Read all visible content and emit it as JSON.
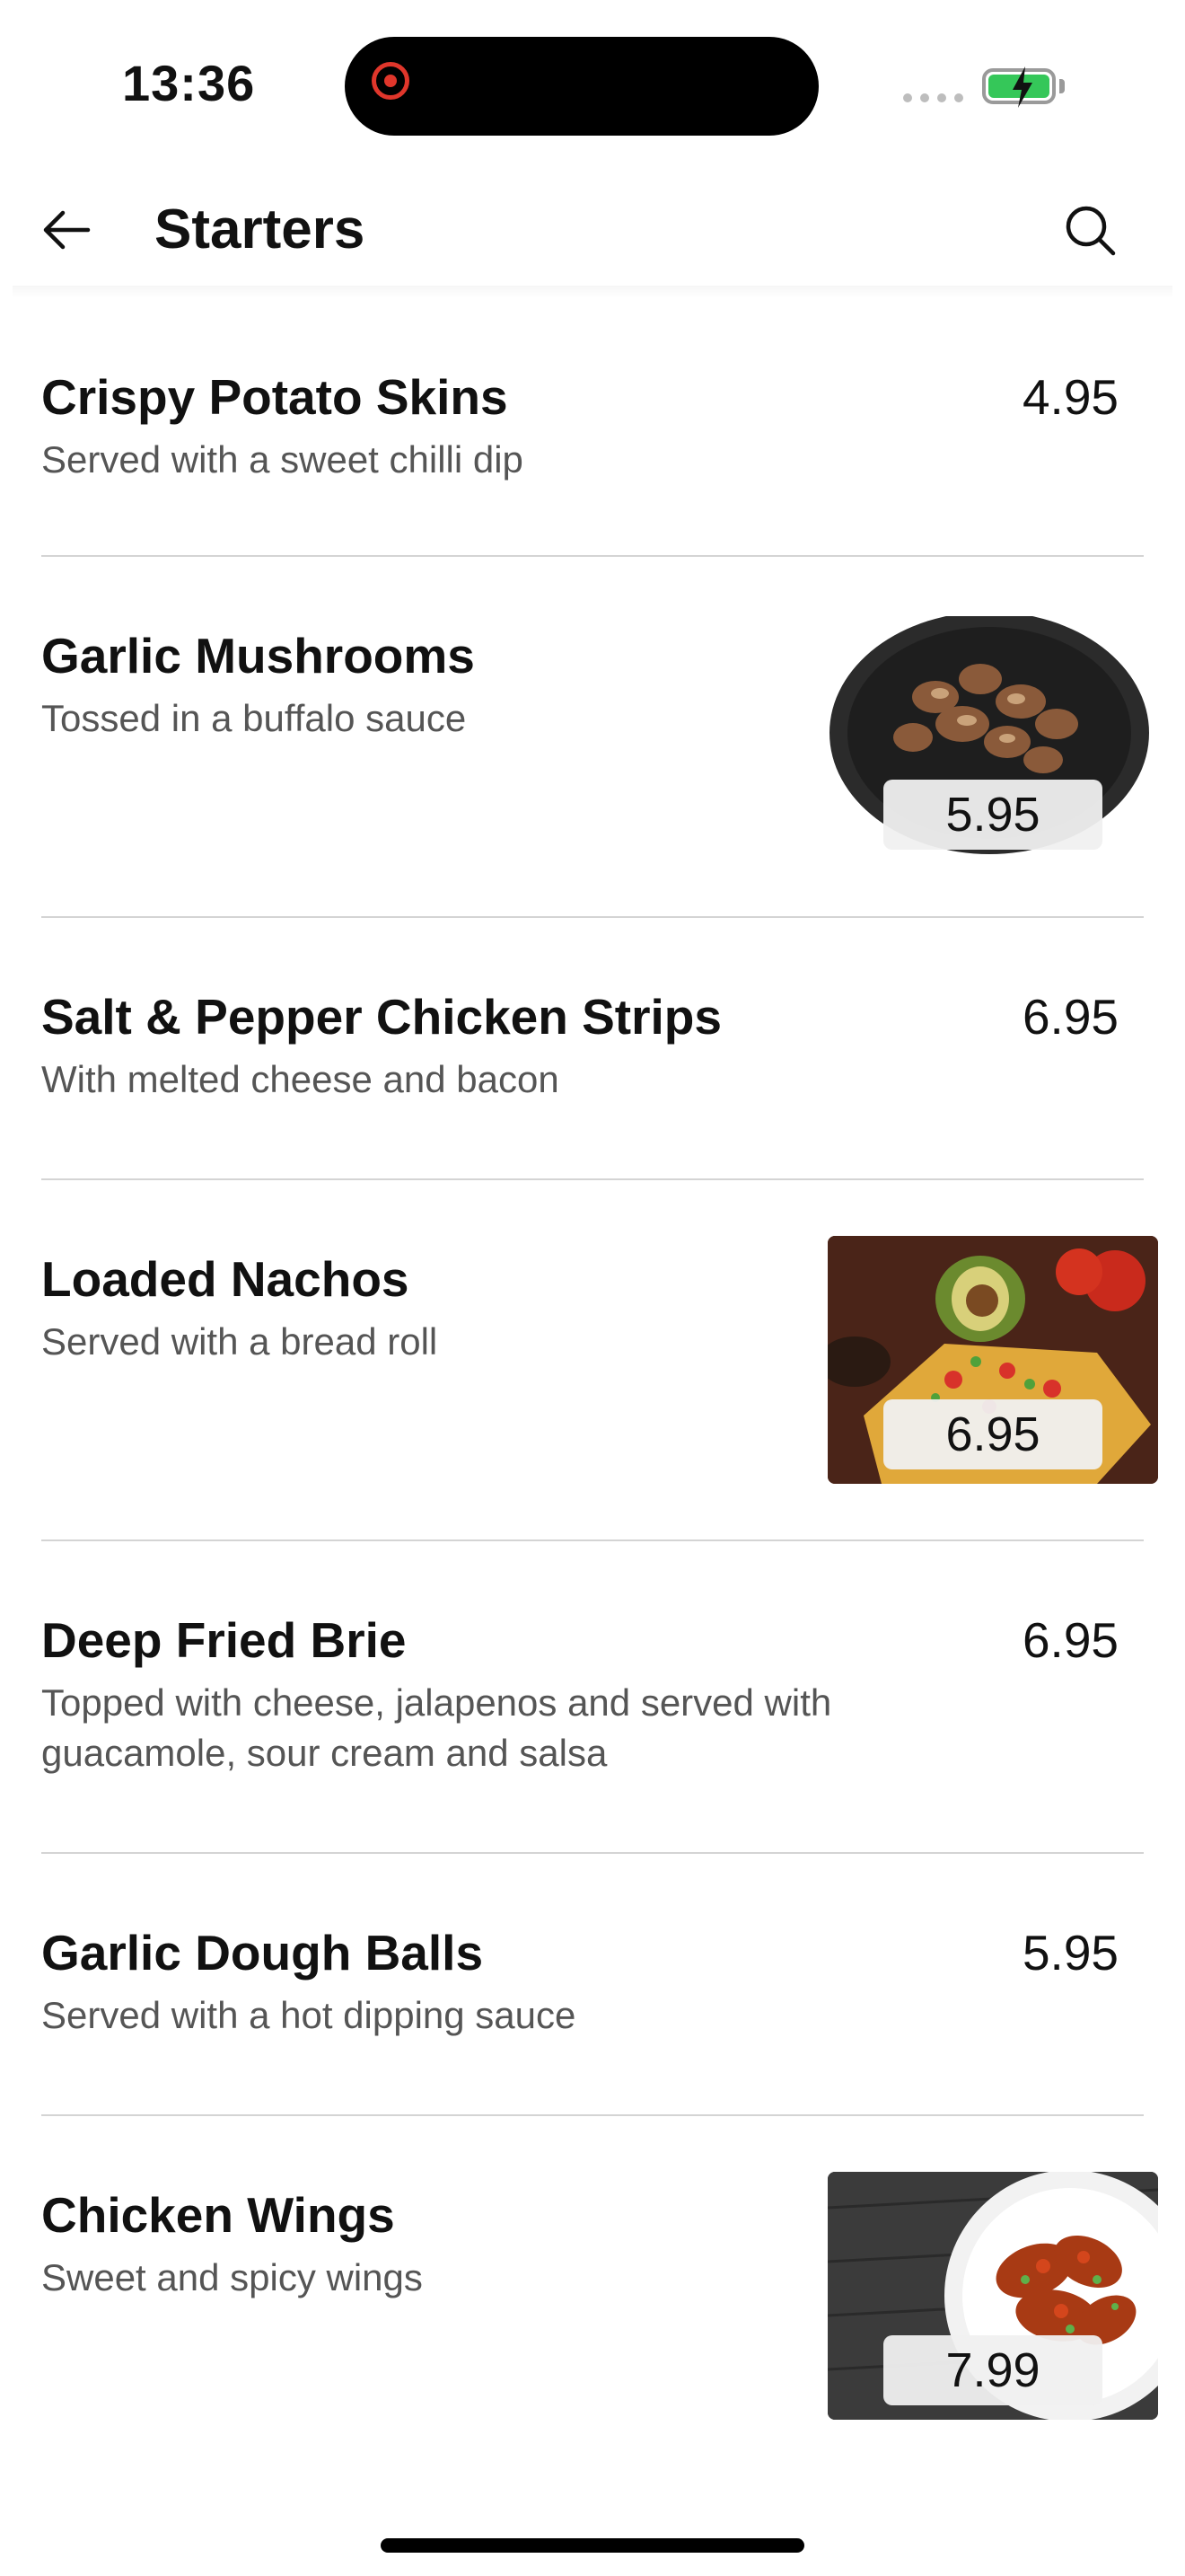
{
  "status_bar": {
    "time": "13:36",
    "battery_state": "charging",
    "recording": true
  },
  "header": {
    "title": "Starters",
    "back_icon": "arrow-left-icon",
    "search_icon": "search-icon"
  },
  "menu_items": [
    {
      "name": "Crispy Potato Skins",
      "description": "Served with a sweet chilli dip",
      "price": "4.95",
      "image": null
    },
    {
      "name": "Garlic Mushrooms",
      "description": "Tossed in a buffalo sauce",
      "price": "5.95",
      "image": "garlic-mushrooms-photo"
    },
    {
      "name": "Salt & Pepper Chicken Strips",
      "description": "With melted cheese and bacon",
      "price": "6.95",
      "image": null
    },
    {
      "name": "Loaded Nachos",
      "description": "Served with a bread roll",
      "price": "6.95",
      "image": "loaded-nachos-photo"
    },
    {
      "name": "Deep Fried Brie",
      "description": "Topped with cheese, jalapenos and served with guacamole, sour cream and salsa",
      "price": "6.95",
      "image": null
    },
    {
      "name": "Garlic Dough Balls",
      "description": "Served with a hot dipping sauce",
      "price": "5.95",
      "image": null
    },
    {
      "name": "Chicken Wings",
      "description": "Sweet and spicy wings",
      "price": "7.99",
      "image": "chicken-wings-photo"
    }
  ],
  "colors": {
    "accent_battery": "#35c759",
    "record": "#e0362b",
    "divider": "#d4d4d4",
    "description_text": "#555555"
  }
}
